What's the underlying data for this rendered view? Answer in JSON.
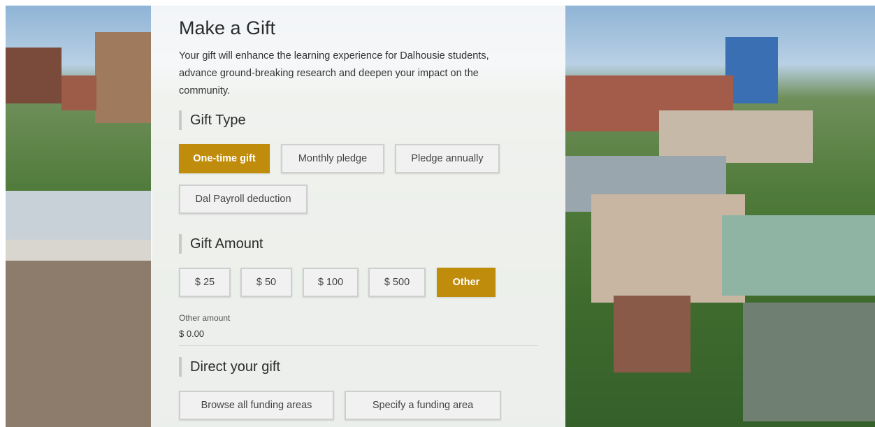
{
  "page_title": "Make a Gift",
  "intro": "Your gift will enhance the learning experience for Dalhousie students, advance ground-breaking research and deepen your impact on the community.",
  "gift_type": {
    "title": "Gift Type",
    "options": [
      "One-time gift",
      "Monthly pledge",
      "Pledge annually",
      "Dal Payroll deduction"
    ],
    "selected": "One-time gift"
  },
  "gift_amount": {
    "title": "Gift Amount",
    "options": [
      "$ 25",
      "$ 50",
      "$ 100",
      "$ 500",
      "Other"
    ],
    "selected": "Other",
    "other_label": "Other amount",
    "other_value": "$ 0.00"
  },
  "direct_gift": {
    "title": "Direct your gift",
    "options": [
      "Browse all funding areas",
      "Specify a funding area"
    ]
  },
  "colors": {
    "accent": "#c08c0b",
    "button_bg": "#f1f1f1",
    "button_border": "#cfcfcf"
  }
}
